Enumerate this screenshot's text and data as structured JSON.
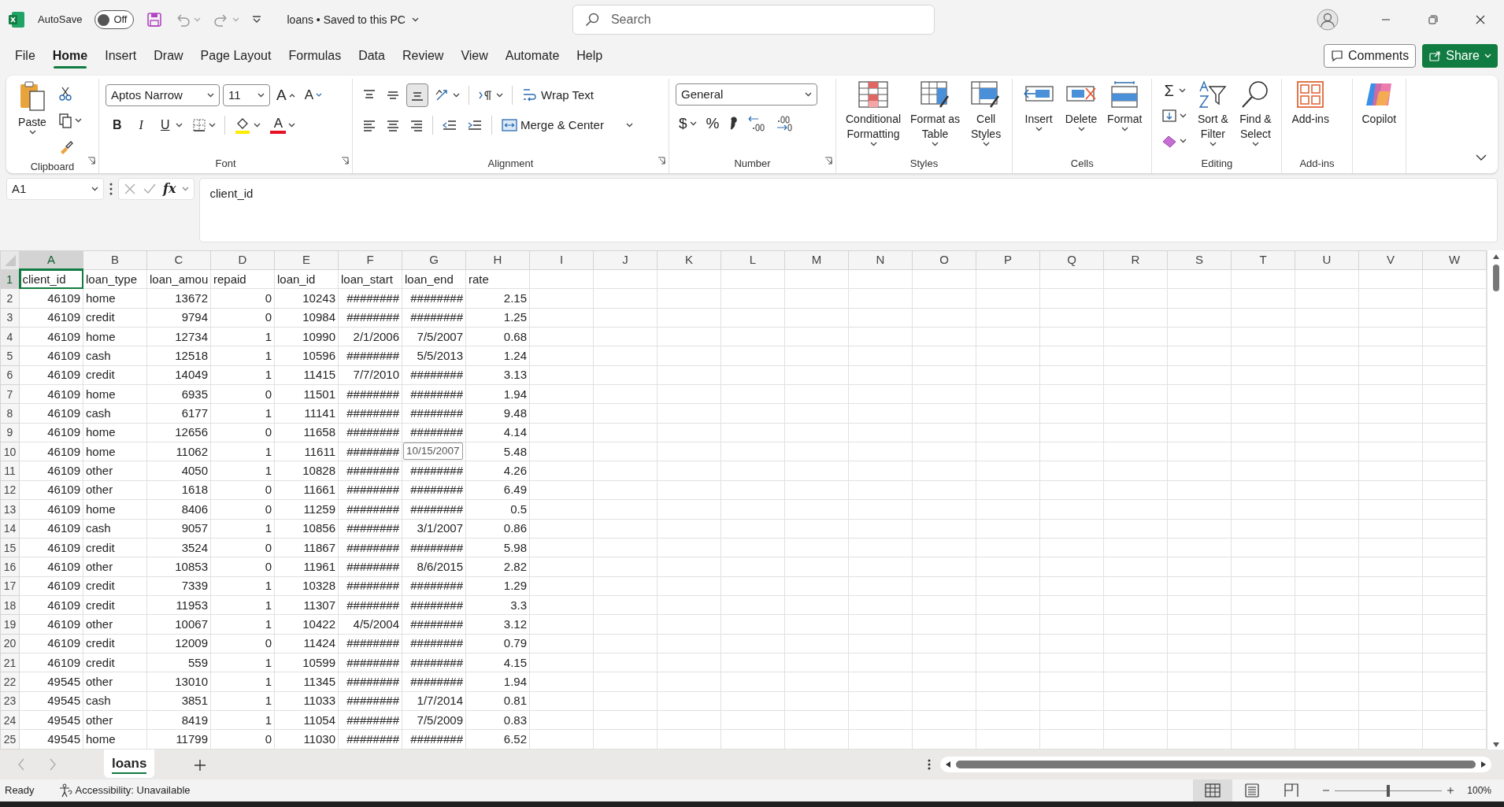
{
  "title_bar": {
    "autosave_label": "AutoSave",
    "autosave": {
      "label": "Off",
      "on": false
    },
    "document_title": "loans • Saved to this PC",
    "search_placeholder": "Search"
  },
  "menu_tabs": [
    {
      "label": "File",
      "selected": false
    },
    {
      "label": "Home",
      "selected": true
    },
    {
      "label": "Insert",
      "selected": false
    },
    {
      "label": "Draw",
      "selected": false
    },
    {
      "label": "Page Layout",
      "selected": false
    },
    {
      "label": "Formulas",
      "selected": false
    },
    {
      "label": "Data",
      "selected": false
    },
    {
      "label": "Review",
      "selected": false
    },
    {
      "label": "View",
      "selected": false
    },
    {
      "label": "Automate",
      "selected": false
    },
    {
      "label": "Help",
      "selected": false
    }
  ],
  "header_buttons": {
    "comments": "Comments",
    "share": "Share"
  },
  "ribbon": {
    "clipboard": {
      "label": "Clipboard",
      "paste": "Paste"
    },
    "font": {
      "label": "Font",
      "font_name": "Aptos Narrow",
      "font_size": "11",
      "size_buttons": [
        "A",
        "A"
      ],
      "style_buttons": [
        "B",
        "I",
        "U"
      ],
      "font_color": "A"
    },
    "alignment": {
      "label": "Alignment",
      "wrap_text": "Wrap Text",
      "merge": "Merge & Center"
    },
    "number": {
      "label": "Number",
      "format": "General",
      "symbols": [
        "$",
        "%"
      ]
    },
    "groups": [
      {
        "label": "Styles",
        "buttons": [
          {
            "kind": "conditional",
            "lines": [
              "Conditional",
              "Formatting"
            ],
            "dropdown": true
          },
          {
            "kind": "table",
            "lines": [
              "Format as",
              "Table"
            ],
            "dropdown": true
          },
          {
            "kind": "cellstyles",
            "lines": [
              "Cell",
              "Styles"
            ],
            "dropdown": true
          }
        ]
      },
      {
        "label": "Cells",
        "buttons": [
          {
            "kind": "insert",
            "lines": [
              "Insert"
            ],
            "dropdown": true
          },
          {
            "kind": "delete",
            "lines": [
              "Delete"
            ],
            "dropdown": true
          },
          {
            "kind": "format",
            "lines": [
              "Format"
            ],
            "dropdown": true
          }
        ]
      },
      {
        "label": "Editing",
        "autosum": "Σ",
        "buttons": [
          {
            "kind": "sort",
            "lines": [
              "Sort &",
              "Filter"
            ],
            "dropdown": true
          },
          {
            "kind": "find",
            "lines": [
              "Find &",
              "Select"
            ],
            "dropdown": true
          }
        ]
      },
      {
        "label": "Add-ins",
        "buttons": [
          {
            "kind": "addins",
            "lines": [
              "Add-ins"
            ],
            "dropdown": false
          }
        ]
      },
      {
        "buttons": [
          {
            "kind": "copilot",
            "lines": [
              "Copilot"
            ],
            "dropdown": false
          }
        ]
      }
    ]
  },
  "formula_bar": {
    "name_box": "A1",
    "fx": "fx",
    "content": "client_id"
  },
  "columns": [
    {
      "letter": "A",
      "selected": true,
      "kind": "number"
    },
    {
      "letter": "B",
      "selected": false,
      "kind": "text"
    },
    {
      "letter": "C",
      "selected": false,
      "kind": "number"
    },
    {
      "letter": "D",
      "selected": false,
      "kind": "number"
    },
    {
      "letter": "E",
      "selected": false,
      "kind": "number"
    },
    {
      "letter": "F",
      "selected": false,
      "kind": "date"
    },
    {
      "letter": "G",
      "selected": false,
      "kind": "date"
    },
    {
      "letter": "H",
      "selected": false,
      "kind": "number"
    },
    {
      "letter": "I",
      "selected": false
    },
    {
      "letter": "J",
      "selected": false
    },
    {
      "letter": "K",
      "selected": false
    },
    {
      "letter": "L",
      "selected": false
    },
    {
      "letter": "M",
      "selected": false
    },
    {
      "letter": "N",
      "selected": false
    },
    {
      "letter": "O",
      "selected": false
    },
    {
      "letter": "P",
      "selected": false
    },
    {
      "letter": "Q",
      "selected": false
    },
    {
      "letter": "R",
      "selected": false
    },
    {
      "letter": "S",
      "selected": false
    },
    {
      "letter": "T",
      "selected": false
    },
    {
      "letter": "U",
      "selected": false
    },
    {
      "letter": "V",
      "selected": false
    },
    {
      "letter": "W",
      "selected": false
    }
  ],
  "rows": [
    {
      "number": "1",
      "kind": "header",
      "selected": true,
      "cells": [
        "client_id",
        "loan_type",
        "loan_amou",
        "repaid",
        "loan_id",
        "loan_start",
        "loan_end",
        "rate"
      ]
    },
    {
      "number": "2",
      "kind": "data",
      "selected": false,
      "cells": [
        "46109",
        "home",
        "13672",
        "0",
        "10243",
        "########",
        "########",
        "2.15"
      ]
    },
    {
      "number": "3",
      "kind": "data",
      "selected": false,
      "cells": [
        "46109",
        "credit",
        "9794",
        "0",
        "10984",
        "########",
        "########",
        "1.25"
      ]
    },
    {
      "number": "4",
      "kind": "data",
      "selected": false,
      "cells": [
        "46109",
        "home",
        "12734",
        "1",
        "10990",
        "2/1/2006",
        "7/5/2007",
        "0.68"
      ]
    },
    {
      "number": "5",
      "kind": "data",
      "selected": false,
      "cells": [
        "46109",
        "cash",
        "12518",
        "1",
        "10596",
        "########",
        "5/5/2013",
        "1.24"
      ]
    },
    {
      "number": "6",
      "kind": "data",
      "selected": false,
      "cells": [
        "46109",
        "credit",
        "14049",
        "1",
        "11415",
        "7/7/2010",
        "########",
        "3.13"
      ]
    },
    {
      "number": "7",
      "kind": "data",
      "selected": false,
      "cells": [
        "46109",
        "home",
        "6935",
        "0",
        "11501",
        "########",
        "########",
        "1.94"
      ]
    },
    {
      "number": "8",
      "kind": "data",
      "selected": false,
      "cells": [
        "46109",
        "cash",
        "6177",
        "1",
        "11141",
        "########",
        "########",
        "9.48"
      ]
    },
    {
      "number": "9",
      "kind": "data",
      "selected": false,
      "cells": [
        "46109",
        "home",
        "12656",
        "0",
        "11658",
        "########",
        "########",
        "4.14"
      ]
    },
    {
      "number": "10",
      "kind": "data",
      "selected": false,
      "cells": [
        "46109",
        "home",
        "11062",
        "1",
        "11611",
        "########",
        {
          "tooltip": "10/15/2007"
        },
        "5.48"
      ]
    },
    {
      "number": "11",
      "kind": "data",
      "selected": false,
      "cells": [
        "46109",
        "other",
        "4050",
        "1",
        "10828",
        "########",
        "########",
        "4.26"
      ]
    },
    {
      "number": "12",
      "kind": "data",
      "selected": false,
      "cells": [
        "46109",
        "other",
        "1618",
        "0",
        "11661",
        "########",
        "########",
        "6.49"
      ]
    },
    {
      "number": "13",
      "kind": "data",
      "selected": false,
      "cells": [
        "46109",
        "home",
        "8406",
        "0",
        "11259",
        "########",
        "########",
        "0.5"
      ]
    },
    {
      "number": "14",
      "kind": "data",
      "selected": false,
      "cells": [
        "46109",
        "cash",
        "9057",
        "1",
        "10856",
        "########",
        "3/1/2007",
        "0.86"
      ]
    },
    {
      "number": "15",
      "kind": "data",
      "selected": false,
      "cells": [
        "46109",
        "credit",
        "3524",
        "0",
        "11867",
        "########",
        "########",
        "5.98"
      ]
    },
    {
      "number": "16",
      "kind": "data",
      "selected": false,
      "cells": [
        "46109",
        "other",
        "10853",
        "0",
        "11961",
        "########",
        "8/6/2015",
        "2.82"
      ]
    },
    {
      "number": "17",
      "kind": "data",
      "selected": false,
      "cells": [
        "46109",
        "credit",
        "7339",
        "1",
        "10328",
        "########",
        "########",
        "1.29"
      ]
    },
    {
      "number": "18",
      "kind": "data",
      "selected": false,
      "cells": [
        "46109",
        "credit",
        "11953",
        "1",
        "11307",
        "########",
        "########",
        "3.3"
      ]
    },
    {
      "number": "19",
      "kind": "data",
      "selected": false,
      "cells": [
        "46109",
        "other",
        "10067",
        "1",
        "10422",
        "4/5/2004",
        "########",
        "3.12"
      ]
    },
    {
      "number": "20",
      "kind": "data",
      "selected": false,
      "cells": [
        "46109",
        "credit",
        "12009",
        "0",
        "11424",
        "########",
        "########",
        "0.79"
      ]
    },
    {
      "number": "21",
      "kind": "data",
      "selected": false,
      "cells": [
        "46109",
        "credit",
        "559",
        "1",
        "10599",
        "########",
        "########",
        "4.15"
      ]
    },
    {
      "number": "22",
      "kind": "data",
      "selected": false,
      "cells": [
        "49545",
        "other",
        "13010",
        "1",
        "11345",
        "########",
        "########",
        "1.94"
      ]
    },
    {
      "number": "23",
      "kind": "data",
      "selected": false,
      "cells": [
        "49545",
        "cash",
        "3851",
        "1",
        "11033",
        "########",
        "1/7/2014",
        "0.81"
      ]
    },
    {
      "number": "24",
      "kind": "data",
      "selected": false,
      "cells": [
        "49545",
        "other",
        "8419",
        "1",
        "11054",
        "########",
        "7/5/2009",
        "0.83"
      ]
    },
    {
      "number": "25",
      "kind": "data",
      "selected": false,
      "cells": [
        "49545",
        "home",
        "11799",
        "0",
        "11030",
        "########",
        "########",
        "6.52"
      ]
    }
  ],
  "sheet_tabs": [
    {
      "label": "loans",
      "selected": true
    }
  ],
  "status_bar": {
    "mode": "Ready",
    "accessibility": "Accessibility: Unavailable",
    "views": [
      {
        "kind": "normal",
        "selected": true
      },
      {
        "kind": "page_layout",
        "selected": false
      },
      {
        "kind": "page_break",
        "selected": false
      }
    ],
    "zoom_slider": {
      "level": 0.5
    },
    "zoom": "100%"
  }
}
